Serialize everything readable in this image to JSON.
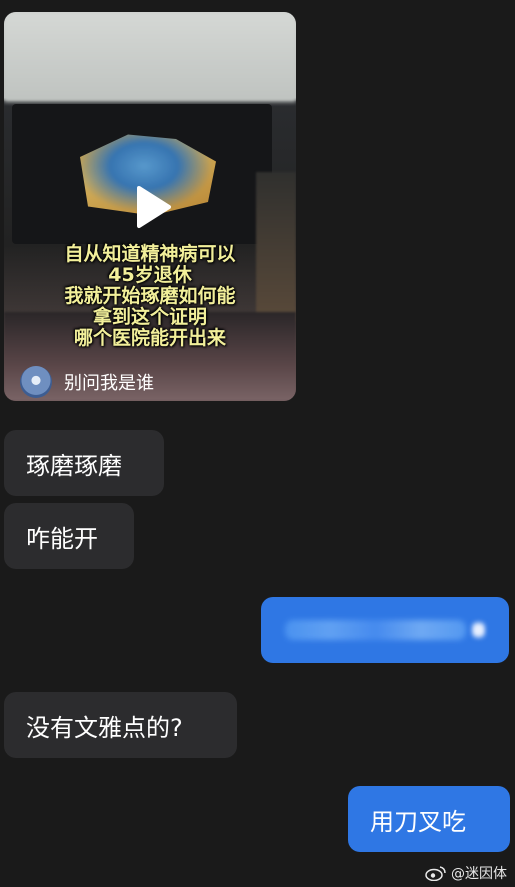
{
  "video": {
    "caption_lines": "自从知道精神病可以\n45岁退休\n我就开始琢磨如何能\n拿到这个证明\n哪个医院能开出来",
    "author_name": "别问我是谁",
    "play_icon": "play-icon"
  },
  "messages": [
    {
      "side": "incoming",
      "text": "琢磨琢磨"
    },
    {
      "side": "incoming",
      "text": "咋能开"
    },
    {
      "side": "outgoing",
      "text": ""
    },
    {
      "side": "incoming",
      "text": "没有文雅点的?"
    },
    {
      "side": "outgoing",
      "text": "用刀叉吃"
    }
  ],
  "watermark": {
    "text": "@迷因体",
    "icon": "weibo-icon"
  },
  "colors": {
    "background": "#1a1a1a",
    "incoming_bubble": "#2c2c2e",
    "outgoing_bubble": "#2f77e4",
    "caption": "#f2ef9a"
  }
}
